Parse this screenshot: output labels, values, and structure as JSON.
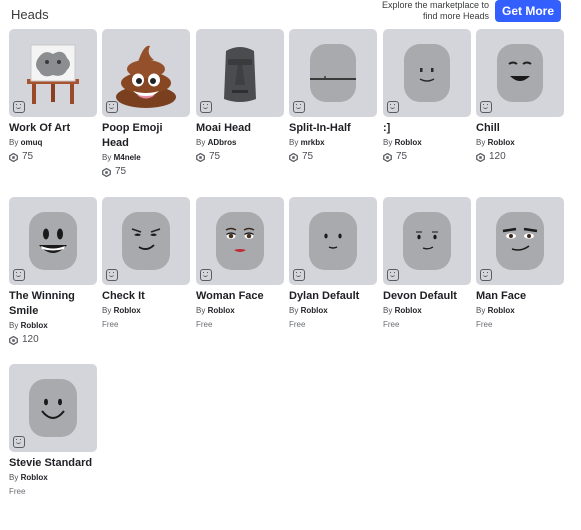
{
  "header": {
    "section_title": "Heads",
    "promo_line1": "Explore the marketplace to",
    "promo_line2": "find more Heads",
    "get_more_label": "Get More"
  },
  "colors": {
    "accent": "#335fff",
    "tile_bg": "#d4d5da"
  },
  "items": [
    {
      "name": "Work Of Art",
      "by": "By",
      "creator": "omuq",
      "price": "75",
      "icon": "easel-painting-art"
    },
    {
      "name": "Poop Emoji Head",
      "by": "By",
      "creator": "M4nele",
      "price": "75",
      "icon": "poop-emoji-art"
    },
    {
      "name": "Moai Head",
      "by": "By",
      "creator": "ADbros",
      "price": "75",
      "icon": "moai-art"
    },
    {
      "name": "Split-In-Half",
      "by": "By",
      "creator": "mrkbx",
      "price": "75",
      "icon": "split-head-art"
    },
    {
      "name": ":]",
      "by": "By",
      "creator": "Roblox",
      "price": "75",
      "icon": "smile-bracket-head-art"
    },
    {
      "name": "Chill",
      "by": "By",
      "creator": "Roblox",
      "price": "120",
      "icon": "chill-head-art"
    },
    {
      "name": "The Winning Smile",
      "by": "By",
      "creator": "Roblox",
      "price": "120",
      "icon": "winning-smile-head-art"
    },
    {
      "name": "Check It",
      "by": "By",
      "creator": "Roblox",
      "price": "Free",
      "icon": "check-it-head-art"
    },
    {
      "name": "Woman Face",
      "by": "By",
      "creator": "Roblox",
      "price": "Free",
      "icon": "woman-face-head-art"
    },
    {
      "name": "Dylan Default",
      "by": "By",
      "creator": "Roblox",
      "price": "Free",
      "icon": "dylan-head-art"
    },
    {
      "name": "Devon Default",
      "by": "By",
      "creator": "Roblox",
      "price": "Free",
      "icon": "devon-head-art"
    },
    {
      "name": "Man Face",
      "by": "By",
      "creator": "Roblox",
      "price": "Free",
      "icon": "man-face-head-art"
    },
    {
      "name": "Stevie Standard",
      "by": "By",
      "creator": "Roblox",
      "price": "Free",
      "icon": "stevie-head-art"
    }
  ]
}
